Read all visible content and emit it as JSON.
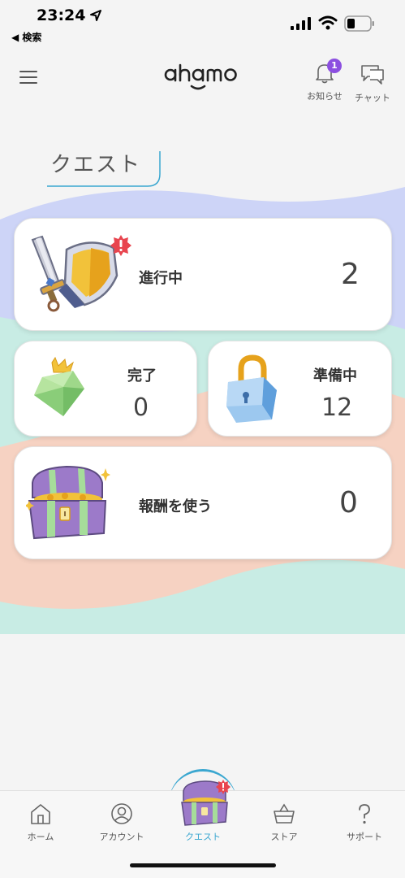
{
  "status_bar": {
    "time": "23:24",
    "back_app": "◀ 検索"
  },
  "header": {
    "logo_text": "ahamo",
    "notifications_label": "お知らせ",
    "notifications_badge": "1",
    "chat_label": "チャット"
  },
  "page": {
    "title": "クエスト"
  },
  "cards": {
    "in_progress": {
      "label": "進行中",
      "count": "2"
    },
    "completed": {
      "label": "完了",
      "count": "0"
    },
    "preparing": {
      "label": "準備中",
      "count": "12"
    },
    "rewards": {
      "label": "報酬を使う",
      "count": "0"
    }
  },
  "tabs": [
    {
      "label": "ホーム",
      "icon": "home-icon"
    },
    {
      "label": "アカウント",
      "icon": "account-icon"
    },
    {
      "label": "クエスト",
      "icon": "treasure-chest-icon",
      "active": true
    },
    {
      "label": "ストア",
      "icon": "basket-icon"
    },
    {
      "label": "サポート",
      "icon": "question-icon"
    }
  ],
  "colors": {
    "accent": "#3aa7d0",
    "badge": "#8c4fe0",
    "wave_blue": "#cdd4f7",
    "wave_mint": "#c8ece4",
    "wave_peach": "#f6d2c2",
    "alert_red": "#e8454f"
  }
}
